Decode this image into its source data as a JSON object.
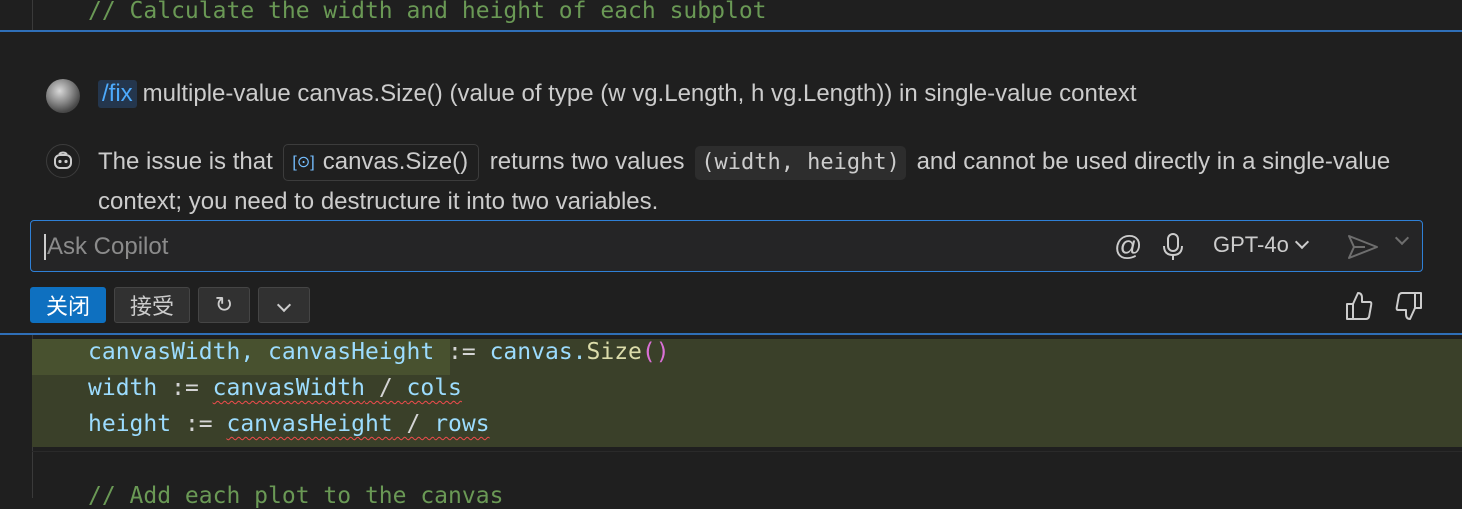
{
  "editor": {
    "comment_top": "// Calculate the width and height of each subplot",
    "comment_bottom": "// Add each plot to the canvas"
  },
  "chat": {
    "user": {
      "command": "/fix",
      "message": "multiple-value canvas.Size() (value of type (w vg.Length, h vg.Length)) in single-value context"
    },
    "response": {
      "part1": "The issue is that",
      "symbol_chip": "canvas.Size()",
      "part2": "returns two values",
      "code_chip": "(width, height)",
      "part3": "and cannot be used directly in a single-value context; you need to destructure it into two variables."
    },
    "input": {
      "placeholder": "Ask Copilot",
      "value": "",
      "at_symbol": "@",
      "model": "GPT-4o"
    },
    "actions": {
      "close_label": "关闭",
      "accept_label": "接受",
      "regenerate_icon": "↻"
    },
    "colors": {
      "accent": "#0e70c0",
      "border": "#2f6fb8",
      "inserted_bg": "#3a4029"
    }
  },
  "code": {
    "line1_a": "canvasWidth, canvasHeight",
    "line1_op": " := ",
    "line1_obj": "canvas.",
    "line1_fn": "Size",
    "line1_paren": "()",
    "line2_var": "width",
    "line2_op": " := ",
    "line2_a": "canvasWidth",
    "line2_div": " / ",
    "line2_b": "cols",
    "line3_var": "height",
    "line3_op": " := ",
    "line3_a": "canvasHeight",
    "line3_div": " / ",
    "line3_b": "rows"
  }
}
